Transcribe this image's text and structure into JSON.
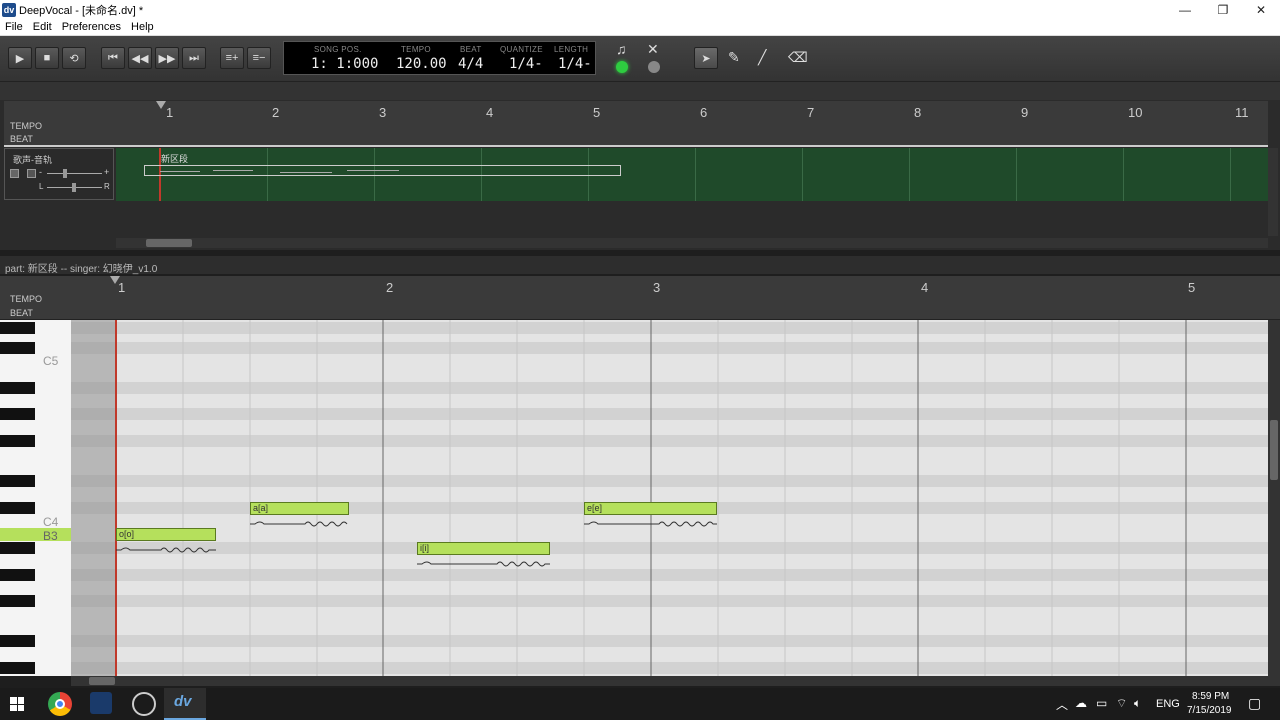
{
  "window": {
    "title": "DeepVocal - [未命名.dv] *",
    "app_icon": "dv",
    "minimize": "—",
    "maximize": "❐",
    "close": "✕"
  },
  "menu": [
    "File",
    "Edit",
    "Preferences",
    "Help"
  ],
  "transport": {
    "song_pos_label": "SONG POS.",
    "song_pos": "1: 1:000",
    "tempo_label": "TEMPO",
    "tempo": "120.00",
    "beat_label": "BEAT",
    "beat": "4/4",
    "quantize_label": "QUANTIZE",
    "quantize": "1/4-",
    "length_label": "LENGTH",
    "length": "1/4-"
  },
  "arrange": {
    "ruler_numbers": [
      "1",
      "2",
      "3",
      "4",
      "5",
      "6",
      "7",
      "8",
      "9",
      "10",
      "11"
    ],
    "tempo_label": "TEMPO",
    "beat_label": "BEAT",
    "track_name": "歌声-音轨",
    "part_name": "新区段",
    "pan_left": "L",
    "pan_right": "R",
    "vol_minus": "-",
    "vol_plus": "+"
  },
  "piano_roll": {
    "part_info": "part: 新区段  --  singer: 幻晓伊_v1.0",
    "tempo_label": "TEMPO",
    "beat_label": "BEAT",
    "ruler_numbers": [
      "1",
      "2",
      "3",
      "4",
      "5"
    ],
    "key_labels": {
      "c5": "C5",
      "c4": "C4",
      "b3": "B3"
    },
    "notes": [
      {
        "lyric": "o[o]",
        "pitch": "B3"
      },
      {
        "lyric": "a[a]",
        "pitch": "C4"
      },
      {
        "lyric": "i[i]",
        "pitch": "A3"
      },
      {
        "lyric": "e[e]",
        "pitch": "C4"
      }
    ]
  },
  "taskbar": {
    "language": "ENG",
    "time": "8:59 PM",
    "date": "7/15/2019"
  },
  "colors": {
    "note_fill": "#b5e05c",
    "track_area": "#1f4a2a",
    "playhead": "#c0392b",
    "led": "#2ecc40"
  }
}
